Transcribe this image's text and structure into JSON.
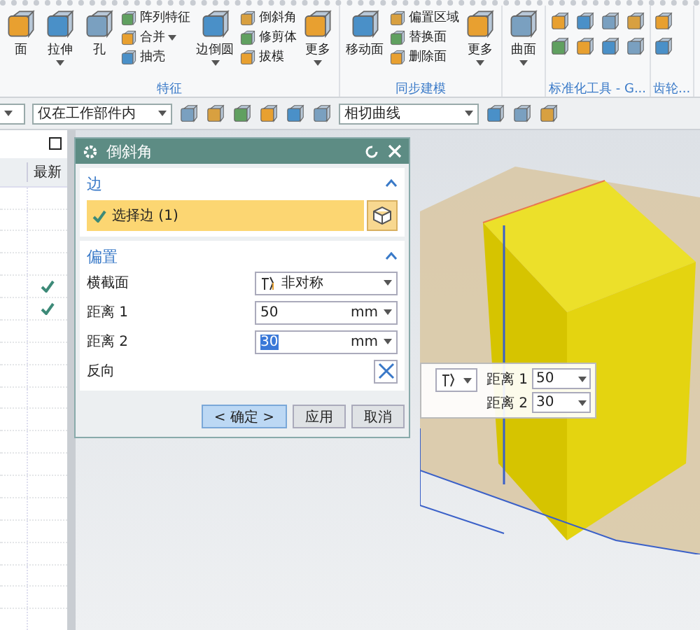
{
  "ribbon": {
    "groups": [
      {
        "label": "特征",
        "items": [
          {
            "kind": "large",
            "label": "面",
            "caret": false
          },
          {
            "kind": "large",
            "label": "拉伸",
            "caret": true
          },
          {
            "kind": "large",
            "label": "孔",
            "caret": false
          },
          {
            "kind": "small",
            "label": "阵列特征",
            "caret": false
          },
          {
            "kind": "small",
            "label": "合并",
            "caret": true
          },
          {
            "kind": "small",
            "label": "抽壳",
            "caret": false
          },
          {
            "kind": "large",
            "label": "边倒圆",
            "caret": true
          },
          {
            "kind": "small",
            "label": "倒斜角",
            "caret": false
          },
          {
            "kind": "small",
            "label": "修剪体",
            "caret": false
          },
          {
            "kind": "small",
            "label": "拔模",
            "caret": false
          },
          {
            "kind": "large",
            "label": "更多",
            "caret": true
          }
        ]
      },
      {
        "label": "同步建模",
        "items": [
          {
            "kind": "large",
            "label": "移动面",
            "caret": false
          },
          {
            "kind": "small",
            "label": "偏置区域",
            "caret": false
          },
          {
            "kind": "small",
            "label": "替换面",
            "caret": false
          },
          {
            "kind": "small",
            "label": "删除面",
            "caret": false
          },
          {
            "kind": "large",
            "label": "更多",
            "caret": true
          }
        ]
      },
      {
        "items": [
          {
            "kind": "large",
            "label": "曲面",
            "caret": true
          }
        ]
      },
      {
        "label": "标准化工具 - G...",
        "items": [
          {
            "kind": "icon"
          },
          {
            "kind": "icon"
          },
          {
            "kind": "icon"
          },
          {
            "kind": "icon"
          },
          {
            "kind": "icon"
          },
          {
            "kind": "icon"
          },
          {
            "kind": "icon"
          },
          {
            "kind": "icon"
          }
        ]
      },
      {
        "label": "齿轮...",
        "items": [
          {
            "kind": "icon"
          },
          {
            "kind": "icon"
          }
        ]
      }
    ]
  },
  "toolbar": {
    "scope_dropdown": "仅在工作部件内",
    "curve_rule_dropdown": "相切曲线"
  },
  "navigator": {
    "column": "最新",
    "rows": [
      {
        "checked": false
      },
      {
        "checked": false
      },
      {
        "checked": false
      },
      {
        "checked": false
      },
      {
        "checked": true
      },
      {
        "checked": true
      },
      {
        "checked": false
      },
      {
        "checked": false
      },
      {
        "checked": false
      },
      {
        "checked": false
      },
      {
        "checked": false
      },
      {
        "checked": false
      },
      {
        "checked": false
      },
      {
        "checked": false
      },
      {
        "checked": false
      },
      {
        "checked": false
      },
      {
        "checked": false
      },
      {
        "checked": false
      },
      {
        "checked": false
      },
      {
        "checked": false
      }
    ]
  },
  "dialog": {
    "title": "倒斜角",
    "edge_section": {
      "title": "边",
      "expanded": true,
      "select": {
        "label": "选择边 (1)",
        "done": true
      }
    },
    "offset_section": {
      "title": "偏置",
      "expanded": true,
      "fields": [
        {
          "kind": "dropdown",
          "label": "横截面",
          "value": "非对称"
        },
        {
          "kind": "number",
          "label": "距离 1",
          "value": "50",
          "unit": "mm",
          "text_selected": false
        },
        {
          "kind": "number",
          "label": "距离 2",
          "value": "30",
          "unit": "mm",
          "text_selected": true
        },
        {
          "kind": "toggle",
          "label": "反向"
        }
      ]
    },
    "buttons": [
      {
        "label": "< 确定 >",
        "default": true
      },
      {
        "label": "应用",
        "default": false
      },
      {
        "label": "取消",
        "default": false
      }
    ]
  },
  "handle_panel": {
    "fields": [
      {
        "label": "距离 1",
        "value": "50"
      },
      {
        "label": "距离 2",
        "value": "30"
      }
    ]
  }
}
